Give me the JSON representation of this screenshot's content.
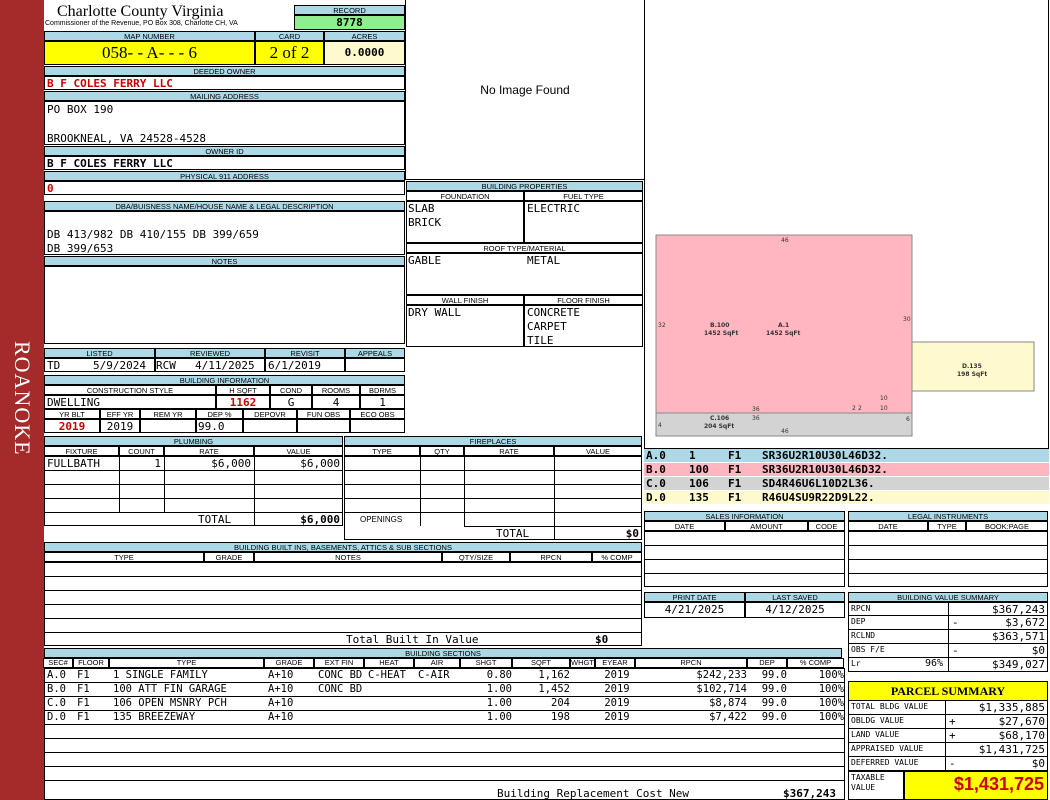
{
  "sidebar": {
    "label": "ROANOKE",
    "color": "#a52a2a"
  },
  "county": {
    "name": "Charlotte County Virginia",
    "address": "Commissioner of the Revenue, PO Box 308, Charlotte CH, VA"
  },
  "record": {
    "label": "RECORD",
    "value": "8778"
  },
  "map": {
    "label": "MAP NUMBER",
    "value": "058- - A- - - 6"
  },
  "card": {
    "label": "CARD",
    "value": "2 of 2"
  },
  "acres": {
    "label": "ACRES",
    "value": "0.0000"
  },
  "owner": {
    "label": "DEEDED OWNER",
    "value": "B F COLES FERRY LLC"
  },
  "mailing": {
    "label": "MAILING ADDRESS",
    "line1": "PO BOX 190",
    "line2": "BROOKNEAL, VA 24528-4528"
  },
  "owner_id": {
    "label": "OWNER ID",
    "value": "B F COLES FERRY LLC"
  },
  "physical": {
    "label": "PHYSICAL 911 ADDRESS",
    "value": "0"
  },
  "legal": {
    "label": "DBA/BUISNESS NAME/HOUSE NAME & LEGAL DESCRIPTION",
    "line1": "DB 413/982 DB 410/155 DB 399/659",
    "line2": "DB 399/653"
  },
  "notes": {
    "label": "NOTES"
  },
  "image": {
    "text": "No Image Found"
  },
  "listed": {
    "headers": [
      "LISTED",
      "REVIEWED",
      "REVISIT",
      "APPEALS"
    ],
    "listed_by": "TD",
    "listed_date": "5/9/2024",
    "reviewed_by": "RCW",
    "reviewed_date": "4/11/2025",
    "revisit": "6/1/2019",
    "appeals": ""
  },
  "building_info": {
    "label": "BUILDING INFORMATION",
    "headers1": [
      "CONSTRUCTION STYLE",
      "H SQFT",
      "COND",
      "ROOMS",
      "BDRMS"
    ],
    "style": "DWELLING",
    "hsqft": "1162",
    "cond": "G",
    "rooms": "4",
    "bdrms": "1",
    "headers2": [
      "YR BLT",
      "EFF YR",
      "REM YR",
      "DEP %",
      "DEPOVR",
      "FUN OBS",
      "ECO OBS"
    ],
    "yr_blt": "2019",
    "eff_yr": "2019",
    "dep": "99.0"
  },
  "building_props": {
    "label": "BUILDING PROPERTIES",
    "foundation_label": "FOUNDATION",
    "fuel_label": "FUEL TYPE",
    "foundation": [
      "SLAB",
      "BRICK"
    ],
    "fuel": "ELECTRIC",
    "roof_label": "ROOF TYPE/MATERIAL",
    "roof_type": "GABLE",
    "roof_mat": "METAL",
    "wall_label": "WALL FINISH",
    "floor_label": "FLOOR FINISH",
    "wall": "DRY WALL",
    "floor": [
      "CONCRETE",
      "CARPET",
      "TILE"
    ]
  },
  "sketch": {
    "labels": [
      {
        "text": "46"
      },
      {
        "text": "32"
      },
      {
        "text": "30"
      },
      {
        "text": "B.100"
      },
      {
        "text": "1452 SqFt"
      },
      {
        "text": "A.1"
      },
      {
        "text": "1452 SqFt"
      },
      {
        "text": "D.135"
      },
      {
        "text": "198 SqFt"
      },
      {
        "text": "C.106"
      },
      {
        "text": "204 SqFt"
      },
      {
        "text": "36"
      },
      {
        "text": "36"
      },
      {
        "text": "2"
      },
      {
        "text": "2"
      },
      {
        "text": "10"
      },
      {
        "text": "10"
      },
      {
        "text": "4"
      },
      {
        "text": "6"
      },
      {
        "text": "46"
      }
    ],
    "pink": "#ffb6c1",
    "gray": "#d3d3d3",
    "yellow": "#fffacd"
  },
  "vectors": [
    {
      "code": "A.0",
      "num": "1",
      "floor": "F1",
      "vec": "SR36U2R10U30L46D32.",
      "color": "#add8e6"
    },
    {
      "code": "B.0",
      "num": "100",
      "floor": "F1",
      "vec": "SR36U2R10U30L46D32.",
      "color": "#ffb6c1"
    },
    {
      "code": "C.0",
      "num": "106",
      "floor": "F1",
      "vec": "SD4R46U6L10D2L36.",
      "color": "#d3d3d3"
    },
    {
      "code": "D.0",
      "num": "135",
      "floor": "F1",
      "vec": "R46U4SU9R22D9L22.",
      "color": "#fffacd"
    }
  ],
  "plumbing": {
    "label": "PLUMBING",
    "headers": [
      "FIXTURE",
      "COUNT",
      "RATE",
      "VALUE"
    ],
    "rows": [
      {
        "fixture": "FULLBATH",
        "count": "1",
        "rate": "$6,000",
        "value": "$6,000"
      }
    ],
    "total_label": "TOTAL",
    "total": "$6,000"
  },
  "fireplaces": {
    "label": "FIREPLACES",
    "headers": [
      "TYPE",
      "QTY",
      "RATE",
      "VALUE"
    ],
    "openings": "OPENINGS",
    "total_label": "TOTAL",
    "total": "$0"
  },
  "sales": {
    "label": "SALES INFORMATION",
    "headers": [
      "DATE",
      "AMOUNT",
      "CODE"
    ]
  },
  "legal_instruments": {
    "label": "LEGAL INSTRUMENTS",
    "headers": [
      "DATE",
      "TYPE",
      "BOOK:PAGE"
    ]
  },
  "builtins": {
    "label": "BUILDING BUILT INS, BASEMENTS, ATTICS & SUB SECTIONS",
    "headers": [
      "TYPE",
      "GRADE",
      "NOTES",
      "QTY/SIZE",
      "RPCN",
      "% COMP"
    ],
    "total_label": "Total Built In Value",
    "total": "$0"
  },
  "print": {
    "print_label": "PRINT DATE",
    "print_date": "4/21/2025",
    "saved_label": "LAST SAVED",
    "saved_date": "4/12/2025"
  },
  "value_summary": {
    "label": "BUILDING VALUE SUMMARY",
    "rows": [
      {
        "label": "RPCN",
        "sign": "",
        "value": "$367,243"
      },
      {
        "label": "DEP",
        "sign": "-",
        "value": "$3,672"
      },
      {
        "label": "RCLND",
        "sign": "",
        "value": "$363,571"
      },
      {
        "label": "OBS F/E",
        "sign": "-",
        "value": "$0"
      },
      {
        "label": "Lr",
        "pct": "96%",
        "sign": "",
        "value": "$349,027"
      }
    ]
  },
  "sections": {
    "label": "BUILDING SECTIONS",
    "headers": [
      "SEC#",
      "FLOOR",
      "TYPE",
      "GRADE",
      "EXT FIN",
      "HEAT",
      "AIR",
      "SHGT",
      "SQFT",
      "WHGT",
      "EYEAR",
      "RPCN",
      "DEP",
      "% COMP"
    ],
    "rows": [
      [
        "A.0",
        "F1",
        "1 SINGLE FAMILY",
        "A+10",
        "CONC BD",
        "C-HEAT",
        "C-AIR",
        "0.80",
        "1,162",
        "",
        "2019",
        "$242,233",
        "99.0",
        "100%"
      ],
      [
        "B.0",
        "F1",
        "100 ATT FIN GARAGE",
        "A+10",
        "CONC BD",
        "",
        "",
        "1.00",
        "1,452",
        "",
        "2019",
        "$102,714",
        "99.0",
        "100%"
      ],
      [
        "C.0",
        "F1",
        "106 OPEN MSNRY PCH",
        "A+10",
        "",
        "",
        "",
        "1.00",
        "204",
        "",
        "2019",
        "$8,874",
        "99.0",
        "100%"
      ],
      [
        "D.0",
        "F1",
        "135 BREEZEWAY",
        "A+10",
        "",
        "",
        "",
        "1.00",
        "198",
        "",
        "2019",
        "$7,422",
        "99.0",
        "100%"
      ]
    ],
    "total_label": "Building Replacement Cost New",
    "total": "$367,243"
  },
  "parcel": {
    "label": "PARCEL SUMMARY",
    "rows": [
      {
        "label": "TOTAL BLDG VALUE",
        "sign": "",
        "value": "$1,335,885"
      },
      {
        "label": "OBLDG VALUE",
        "sign": "+",
        "value": "$27,670"
      },
      {
        "label": "LAND VALUE",
        "sign": "+",
        "value": "$68,170"
      },
      {
        "label": "APPRAISED VALUE",
        "sign": "",
        "value": "$1,431,725"
      },
      {
        "label": "DEFERRED VALUE",
        "sign": "-",
        "value": "$0"
      }
    ],
    "taxable_label": "TAXABLE VALUE",
    "taxable": "$1,431,725"
  }
}
